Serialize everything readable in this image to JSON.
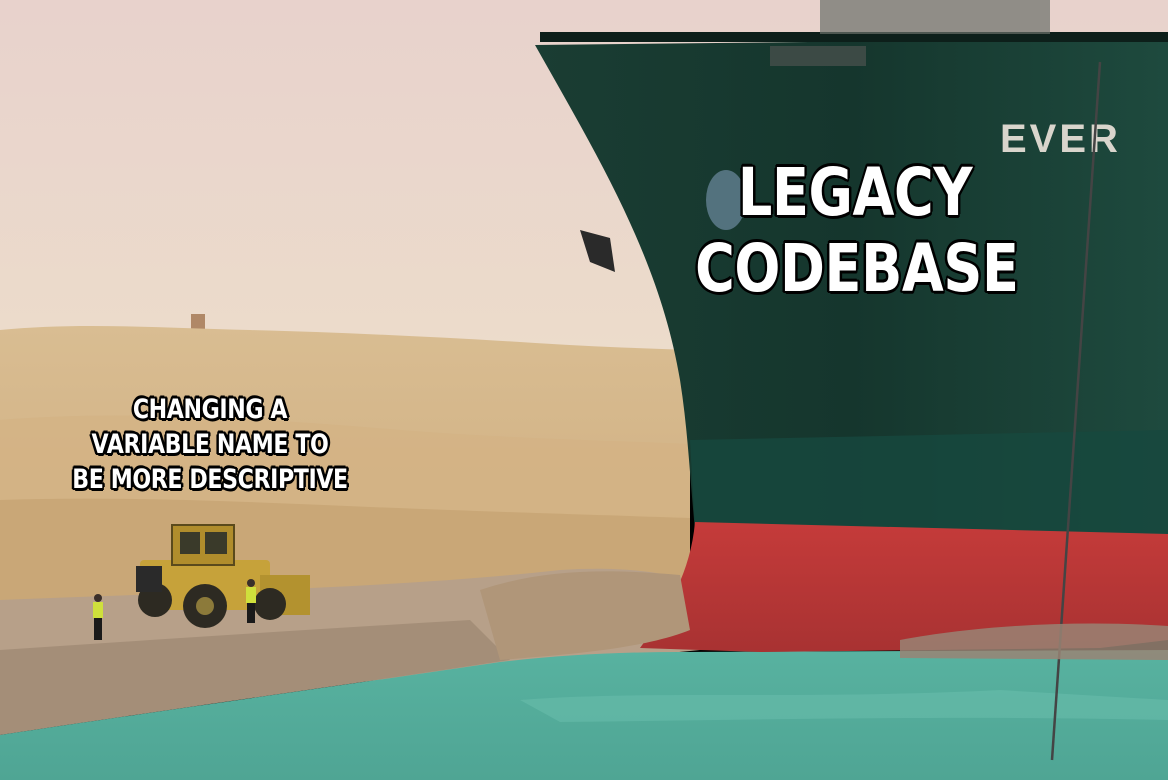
{
  "meme": {
    "top_caption": "LEGACY\nCODEBASE",
    "bottom_caption": "CHANGING A\nVARIABLE NAME TO\nBE MORE DESCRIPTIVE",
    "hull_lettering": "EVER"
  },
  "colors": {
    "sky": "#ead7cd",
    "sand": "#d7b889",
    "hull_green": "#1b3b30",
    "hull_red": "#c13a39",
    "water": "#5fb4a3"
  },
  "scene_elements": [
    "container-ship-bow",
    "bulldozer",
    "worker",
    "canal-water",
    "sand-bank"
  ]
}
